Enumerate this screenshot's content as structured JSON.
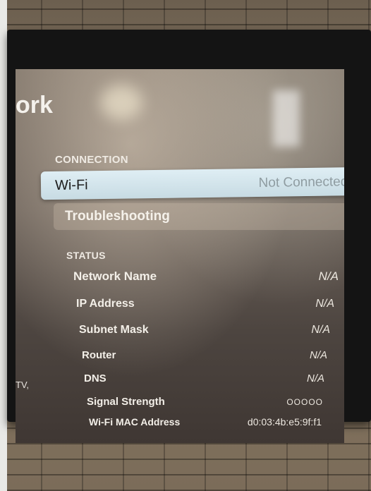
{
  "screen": {
    "title_fragment": "ork",
    "side_caption": "TV,"
  },
  "connection": {
    "heading": "CONNECTION",
    "wifi_label": "Wi-Fi",
    "wifi_value": "Not Connected",
    "troubleshooting_label": "Troubleshooting",
    "chevron": "›"
  },
  "status": {
    "heading": "STATUS",
    "rows": [
      {
        "label": "Network Name",
        "value": "N/A"
      },
      {
        "label": "IP Address",
        "value": "N/A"
      },
      {
        "label": "Subnet Mask",
        "value": "N/A"
      },
      {
        "label": "Router",
        "value": "N/A"
      },
      {
        "label": "DNS",
        "value": "N/A"
      },
      {
        "label": "Signal Strength",
        "value": "OOOOO"
      },
      {
        "label": "Wi-Fi MAC Address",
        "value": "d0:03:4b:e5:9f:f1"
      }
    ]
  },
  "colors": {
    "focus_row": "#d7e8ef",
    "screen_bg": "#6b6159"
  }
}
